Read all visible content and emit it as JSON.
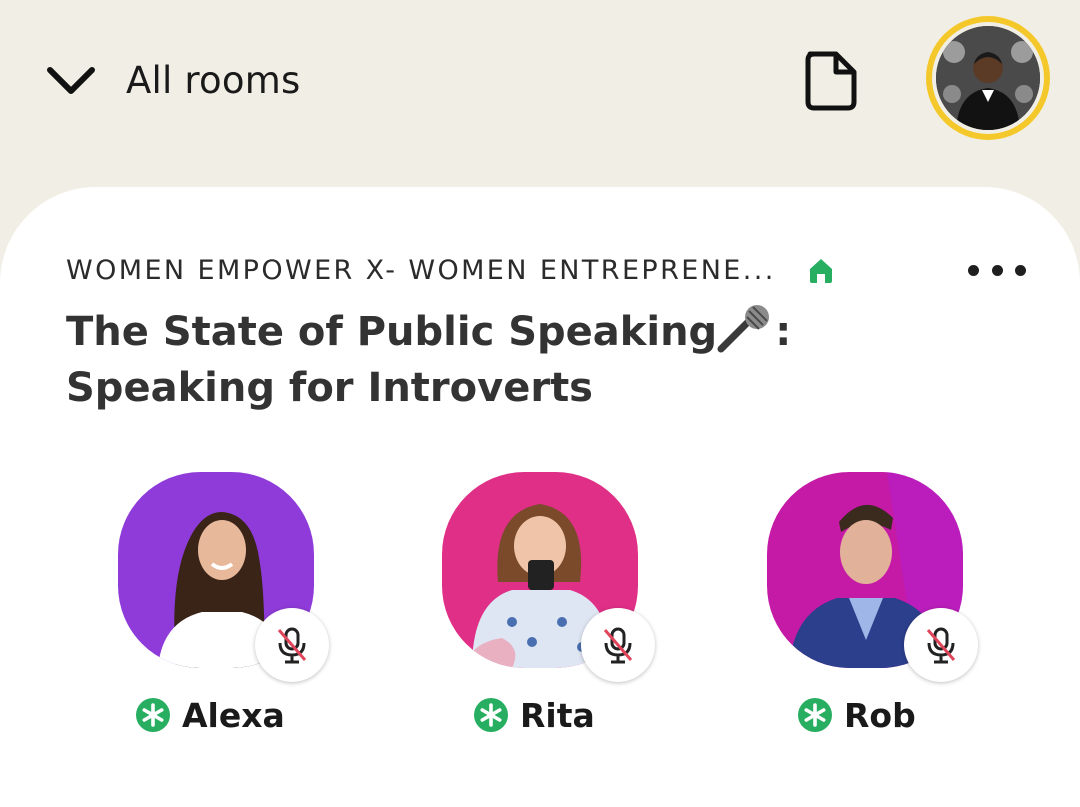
{
  "header": {
    "all_rooms_label": "All rooms"
  },
  "room": {
    "club_name": "WOMEN EMPOWER X- WOMEN ENTREPRENE...",
    "title_line1": "The State of Public Speaking",
    "title_line1_suffix": ":",
    "title_line2": "Speaking for Introverts"
  },
  "speakers": [
    {
      "name": "Alexa",
      "muted": true,
      "bg_color": "#8f3bd9"
    },
    {
      "name": "Rita",
      "muted": true,
      "bg_color": "#e02f86"
    },
    {
      "name": "Rob",
      "muted": true,
      "bg_color": "#c41aa6"
    }
  ],
  "colors": {
    "background": "#f1efe5",
    "card": "#ffffff",
    "profile_ring": "#f4c82a",
    "home_green": "#27ae60",
    "moderator_green": "#27ae60",
    "mute_slash": "#e0455a"
  },
  "icons": {
    "all_rooms": "chevron-down-icon",
    "document": "document-icon",
    "club": "home-icon",
    "more": "more-icon",
    "muted": "mic-off-icon",
    "moderator": "moderator-star-icon"
  }
}
